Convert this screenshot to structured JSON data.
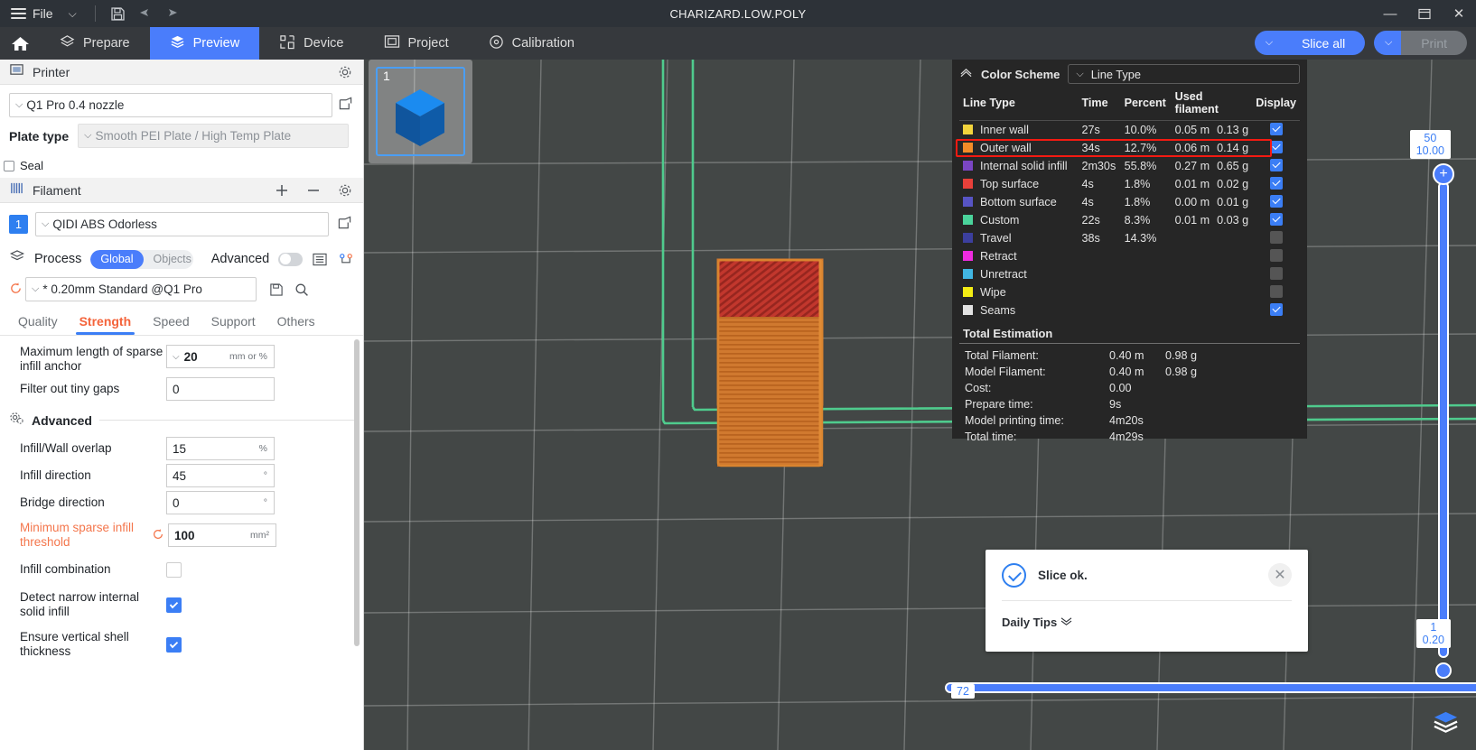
{
  "titlebar": {
    "file_label": "File",
    "project_title": "CHARIZARD.LOW.POLY",
    "icons": [
      "save-icon",
      "undo-icon",
      "redo-icon"
    ],
    "window_min": "—",
    "window_max": "❐",
    "window_close": "✕"
  },
  "topnav": {
    "items": [
      {
        "label": "Prepare",
        "icon": "prepare-icon",
        "active": false
      },
      {
        "label": "Preview",
        "icon": "preview-icon",
        "active": true
      },
      {
        "label": "Device",
        "icon": "device-icon",
        "active": false
      },
      {
        "label": "Project",
        "icon": "project-icon",
        "active": false
      },
      {
        "label": "Calibration",
        "icon": "calibration-icon",
        "active": false
      }
    ],
    "slice_all_label": "Slice all",
    "print_label": "Print"
  },
  "printer": {
    "section_title": "Printer",
    "model": "Q1 Pro 0.4 nozzle",
    "plate_type_label": "Plate type",
    "plate_type_value": "Smooth PEI Plate / High Temp Plate",
    "seal_label": "Seal"
  },
  "filament": {
    "section_title": "Filament",
    "index": "1",
    "name": "QIDI ABS Odorless"
  },
  "process": {
    "section_title": "Process",
    "scope_global": "Global",
    "scope_objects": "Objects",
    "advanced_label": "Advanced",
    "preset": "* 0.20mm Standard @Q1 Pro",
    "tabs": [
      "Quality",
      "Strength",
      "Speed",
      "Support",
      "Others"
    ],
    "active_tab": "Strength"
  },
  "settings": {
    "top_rows": [
      {
        "label": "Maximum length of sparse infill anchor",
        "value": "20",
        "unit": "mm or %",
        "type": "dropdown-input"
      },
      {
        "label": "Filter out tiny gaps",
        "value": "0",
        "unit": "",
        "type": "input"
      }
    ],
    "advanced_title": "Advanced",
    "advanced_rows": [
      {
        "label": "Infill/Wall overlap",
        "value": "15",
        "unit": "%",
        "type": "input",
        "orange": false
      },
      {
        "label": "Infill direction",
        "value": "45",
        "unit": "°",
        "type": "input",
        "orange": false
      },
      {
        "label": "Bridge direction",
        "value": "0",
        "unit": "°",
        "type": "input",
        "orange": false
      },
      {
        "label": "Minimum sparse infill threshold",
        "value": "100",
        "unit": "mm²",
        "type": "input",
        "orange": true,
        "reset": true
      },
      {
        "label": "Infill combination",
        "value": "",
        "unit": "",
        "type": "checkbox",
        "checked": false,
        "orange": false
      },
      {
        "label": "Detect narrow internal solid infill",
        "value": "",
        "unit": "",
        "type": "checkbox",
        "checked": true,
        "orange": false
      },
      {
        "label": "Ensure vertical shell thickness",
        "value": "",
        "unit": "",
        "type": "checkbox",
        "checked": true,
        "orange": false
      }
    ]
  },
  "viewport": {
    "thumbnail_number": "1"
  },
  "legend": {
    "title": "Color Scheme",
    "scheme_value": "Line Type",
    "columns": [
      "Line Type",
      "Time",
      "Percent",
      "Used filament",
      "Display"
    ],
    "rows": [
      {
        "name": "Inner wall",
        "color": "#f2d33c",
        "time": "27s",
        "percent": "10.0%",
        "length": "0.05 m",
        "weight": "0.13 g",
        "display": true
      },
      {
        "name": "Outer wall",
        "color": "#f28c28",
        "time": "34s",
        "percent": "12.7%",
        "length": "0.06 m",
        "weight": "0.14 g",
        "display": true
      },
      {
        "name": "Internal solid infill",
        "color": "#7b46c4",
        "time": "2m30s",
        "percent": "55.8%",
        "length": "0.27 m",
        "weight": "0.65 g",
        "display": true,
        "highlight": true
      },
      {
        "name": "Top surface",
        "color": "#e8403a",
        "time": "4s",
        "percent": "1.8%",
        "length": "0.01 m",
        "weight": "0.02 g",
        "display": true
      },
      {
        "name": "Bottom surface",
        "color": "#5754c4",
        "time": "4s",
        "percent": "1.8%",
        "length": "0.00 m",
        "weight": "0.01 g",
        "display": true
      },
      {
        "name": "Custom",
        "color": "#4ad39b",
        "time": "22s",
        "percent": "8.3%",
        "length": "0.01 m",
        "weight": "0.03 g",
        "display": true
      },
      {
        "name": "Travel",
        "color": "#3c3f9e",
        "time": "38s",
        "percent": "14.3%",
        "length": "",
        "weight": "",
        "display": false
      },
      {
        "name": "Retract",
        "color": "#ef2be0",
        "time": "",
        "percent": "",
        "length": "",
        "weight": "",
        "display": false
      },
      {
        "name": "Unretract",
        "color": "#41b6e3",
        "time": "",
        "percent": "",
        "length": "",
        "weight": "",
        "display": false
      },
      {
        "name": "Wipe",
        "color": "#f3ec14",
        "time": "",
        "percent": "",
        "length": "",
        "weight": "",
        "display": false
      },
      {
        "name": "Seams",
        "color": "#e2e2e2",
        "time": "",
        "percent": "",
        "length": "",
        "weight": "",
        "display": true
      }
    ],
    "total_title": "Total Estimation",
    "totals": [
      {
        "label": "Total Filament:",
        "v1": "0.40 m",
        "v2": "0.98 g"
      },
      {
        "label": "Model Filament:",
        "v1": "0.40 m",
        "v2": "0.98 g"
      },
      {
        "label": "Cost:",
        "v1": "0.00",
        "v2": ""
      },
      {
        "label": "Prepare time:",
        "v1": "9s",
        "v2": ""
      },
      {
        "label": "Model printing time:",
        "v1": "4m20s",
        "v2": ""
      },
      {
        "label": "Total time:",
        "v1": "4m29s",
        "v2": ""
      }
    ]
  },
  "notification": {
    "message": "Slice ok.",
    "tips_label": "Daily Tips"
  },
  "sliders": {
    "vertical_top_layer": "50",
    "vertical_top_height": "10.00",
    "vertical_bottom_layer": "1",
    "vertical_bottom_height": "0.20",
    "horizontal_value": "72"
  },
  "colors": {
    "accent": "#4a7dfb",
    "orange": "#f4633a",
    "highlight_border": "#f41a12",
    "viewport_bg": "#434746"
  }
}
